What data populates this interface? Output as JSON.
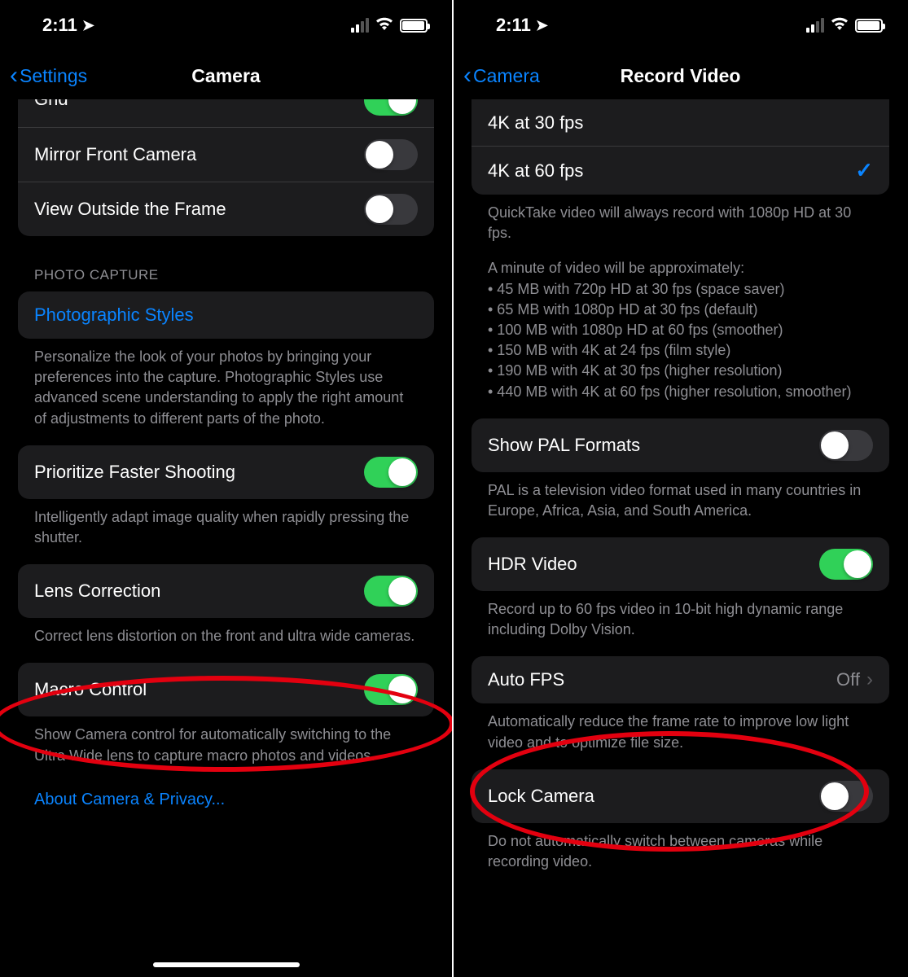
{
  "status": {
    "time": "2:11",
    "signal_bars_active": 2
  },
  "left": {
    "back_label": "Settings",
    "title": "Camera",
    "row_grid": "Grid",
    "row_mirror": "Mirror Front Camera",
    "row_view_outside": "View Outside the Frame",
    "section_photo_capture": "PHOTO CAPTURE",
    "row_photo_styles": "Photographic Styles",
    "photo_styles_footer": "Personalize the look of your photos by bringing your preferences into the capture. Photographic Styles use advanced scene understanding to apply the right amount of adjustments to different parts of the photo.",
    "row_prioritize": "Prioritize Faster Shooting",
    "prioritize_footer": "Intelligently adapt image quality when rapidly pressing the shutter.",
    "row_lens": "Lens Correction",
    "lens_footer": "Correct lens distortion on the front and ultra wide cameras.",
    "row_macro": "Macro Control",
    "macro_footer": "Show Camera control for automatically switching to the Ultra Wide lens to capture macro photos and videos.",
    "about_link": "About Camera & Privacy..."
  },
  "right": {
    "back_label": "Camera",
    "title": "Record Video",
    "row_4k30": "4K at 30 fps",
    "row_4k60": "4K at 60 fps",
    "quicktake_note": "QuickTake video will always record with 1080p HD at 30 fps.",
    "minute_intro": "A minute of video will be approximately:",
    "bullets": [
      "• 45 MB with 720p HD at 30 fps (space saver)",
      "• 65 MB with 1080p HD at 30 fps (default)",
      "• 100 MB with 1080p HD at 60 fps (smoother)",
      "• 150 MB with 4K at 24 fps (film style)",
      "• 190 MB with 4K at 30 fps (higher resolution)",
      "• 440 MB with 4K at 60 fps (higher resolution, smoother)"
    ],
    "row_pal": "Show PAL Formats",
    "pal_footer": "PAL is a television video format used in many countries in Europe, Africa, Asia, and South America.",
    "row_hdr": "HDR Video",
    "hdr_footer": "Record up to 60 fps video in 10-bit high dynamic range including Dolby Vision.",
    "row_autofps": "Auto FPS",
    "row_autofps_value": "Off",
    "autofps_footer": "Automatically reduce the frame rate to improve low light video and to optimize file size.",
    "row_lock": "Lock Camera",
    "lock_footer": "Do not automatically switch between cameras while recording video."
  }
}
